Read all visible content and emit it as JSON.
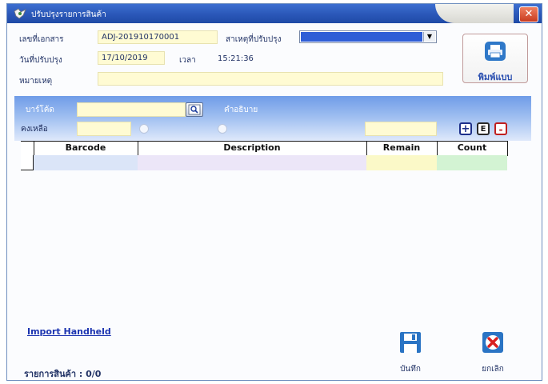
{
  "window": {
    "title": "ปรับปรุงรายการสินค้า",
    "close_label": "✕"
  },
  "header": {
    "doc_no_label": "เลขที่เอกสาร",
    "doc_no_value": "ADJ-201910170001",
    "reason_label": "สาเหตุที่ปรับปรุง",
    "reason_value": "",
    "date_label": "วันที่ปรับปรุง",
    "date_value": "17/10/2019",
    "time_label": "เวลา",
    "time_value": "15:21:36",
    "note_label": "หมายเหตุ",
    "note_value": ""
  },
  "print_button": {
    "label": "พิมพ์แบบ",
    "icon": "printer-icon"
  },
  "entry": {
    "barcode_label": "บาร์โค้ด",
    "barcode_value": "",
    "description_label": "คำอธิบาย",
    "remain_label": "คงเหลือ",
    "remain_value": "",
    "count_value": "",
    "add_label": "+",
    "edit_label": "E",
    "delete_label": "-"
  },
  "grid": {
    "columns": [
      "Barcode",
      "Description",
      "Remain",
      "Count"
    ],
    "rows": []
  },
  "footer": {
    "import_link": "Import Handheld",
    "items_label": "รายการสินค้า : 0/0",
    "save_label": "บันทึก",
    "cancel_label": "ยกเลิก"
  },
  "colors": {
    "title_bar": "#2a57b8",
    "field_yellow": "#fffbd3",
    "panel_blue": "#8fb3ee",
    "link_blue": "#1c34b0"
  }
}
